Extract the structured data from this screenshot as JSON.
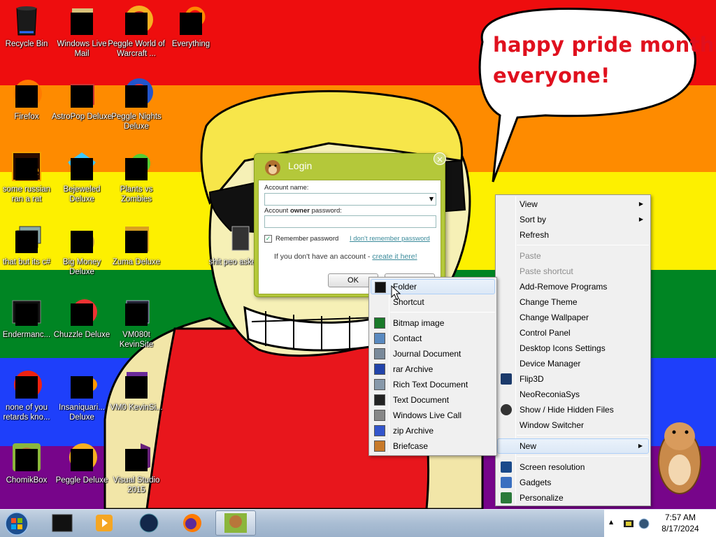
{
  "desktop": {
    "icons": [
      {
        "label": "Recycle Bin"
      },
      {
        "label": "Windows Live Mail"
      },
      {
        "label": "Peggle World of Warcraft ..."
      },
      {
        "label": "Everything"
      },
      {
        "label": "Firefox"
      },
      {
        "label": "AstroPop Deluxe"
      },
      {
        "label": "Peggle Nights Deluxe"
      },
      {
        "label": "some russian ran a rat"
      },
      {
        "label": "Bejeweled Deluxe"
      },
      {
        "label": "Plants vs Zombies"
      },
      {
        "label": "that but its c#"
      },
      {
        "label": "Big Money Deluxe"
      },
      {
        "label": "Zuma Deluxe"
      },
      {
        "label": "shit peo asked m"
      },
      {
        "label": "Endermanc..."
      },
      {
        "label": "Chuzzle Deluxe"
      },
      {
        "label": "VM080t KevinSite"
      },
      {
        "label": "none of you retards kno..."
      },
      {
        "label": "Insaniquari... Deluxe"
      },
      {
        "label": "VM0 KevinSi..."
      },
      {
        "label": "ChomikBox"
      },
      {
        "label": "Peggle Deluxe"
      },
      {
        "label": "Visual Studio 2015"
      }
    ]
  },
  "bubble": {
    "line1": "happy pride month",
    "line2": "everyone!"
  },
  "login": {
    "title": "Login",
    "close_glyph": "×",
    "account_label": "Account name:",
    "password_label_pre": "Account ",
    "password_label_bold": "owner",
    "password_label_post": " password:",
    "remember_label": "Remember password",
    "forgot_link": "I don't remember password",
    "no_account_text": "If you don't have an account - ",
    "create_link": "create it here!",
    "ok_label": "OK"
  },
  "main_menu": {
    "items": [
      {
        "label": "View",
        "sub": true
      },
      {
        "label": "Sort by",
        "sub": true
      },
      {
        "label": "Refresh"
      },
      {
        "label": "Paste",
        "disabled": true
      },
      {
        "label": "Paste shortcut",
        "disabled": true
      },
      {
        "label": "Add-Remove Programs"
      },
      {
        "label": "Change Theme"
      },
      {
        "label": "Change Wallpaper"
      },
      {
        "label": "Control Panel"
      },
      {
        "label": "Desktop Icons Settings"
      },
      {
        "label": "Device Manager"
      },
      {
        "label": "Flip3D"
      },
      {
        "label": "NeoReconiaSys"
      },
      {
        "label": "Show / Hide Hidden Files"
      },
      {
        "label": "Window Switcher"
      },
      {
        "label": "New",
        "sub": true
      },
      {
        "label": "Screen resolution"
      },
      {
        "label": "Gadgets"
      },
      {
        "label": "Personalize"
      }
    ],
    "arrow_glyph": "▶"
  },
  "new_menu": {
    "items": [
      {
        "label": "Folder"
      },
      {
        "label": "Shortcut"
      },
      {
        "label": "Bitmap image"
      },
      {
        "label": "Contact"
      },
      {
        "label": "Journal Document"
      },
      {
        "label": "rar Archive"
      },
      {
        "label": "Rich Text Document"
      },
      {
        "label": "Text Document"
      },
      {
        "label": "Windows Live Call"
      },
      {
        "label": "zip Archive"
      },
      {
        "label": "Briefcase"
      }
    ]
  },
  "taskbar": {
    "time": "7:57 AM",
    "date": "8/17/2024",
    "tray_arrow": "▲"
  },
  "colors": {
    "red": "#ee0d0e",
    "orange": "#fe8b00",
    "yellow": "#fdf000",
    "green": "#008523",
    "blue": "#1e3ffa",
    "purple": "#77058a",
    "bubble_text": "#e0101e"
  }
}
